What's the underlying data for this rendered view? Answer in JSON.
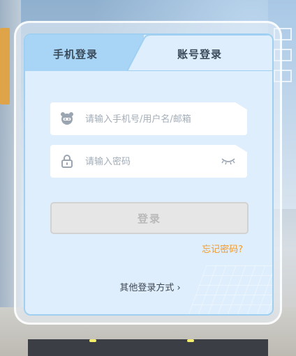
{
  "tabs": [
    {
      "label": "手机登录",
      "active": false
    },
    {
      "label": "账号登录",
      "active": true
    }
  ],
  "form": {
    "account": {
      "placeholder": "请输入手机号/用户名/邮箱",
      "value": "",
      "icon": "user-avatar-icon"
    },
    "password": {
      "placeholder": "请输入密码",
      "value": "",
      "icon": "lock-icon",
      "toggle_icon": "eye-closed-icon"
    },
    "login_label": "登录",
    "forgot_label": "忘记密码?",
    "other_label": "其他登录方式 ›"
  },
  "colors": {
    "accent_tab": "#a8d5f6",
    "panel_bg": "#dfeefc",
    "forgot": "#f19a2e",
    "button_disabled": "#e6e6e6"
  }
}
